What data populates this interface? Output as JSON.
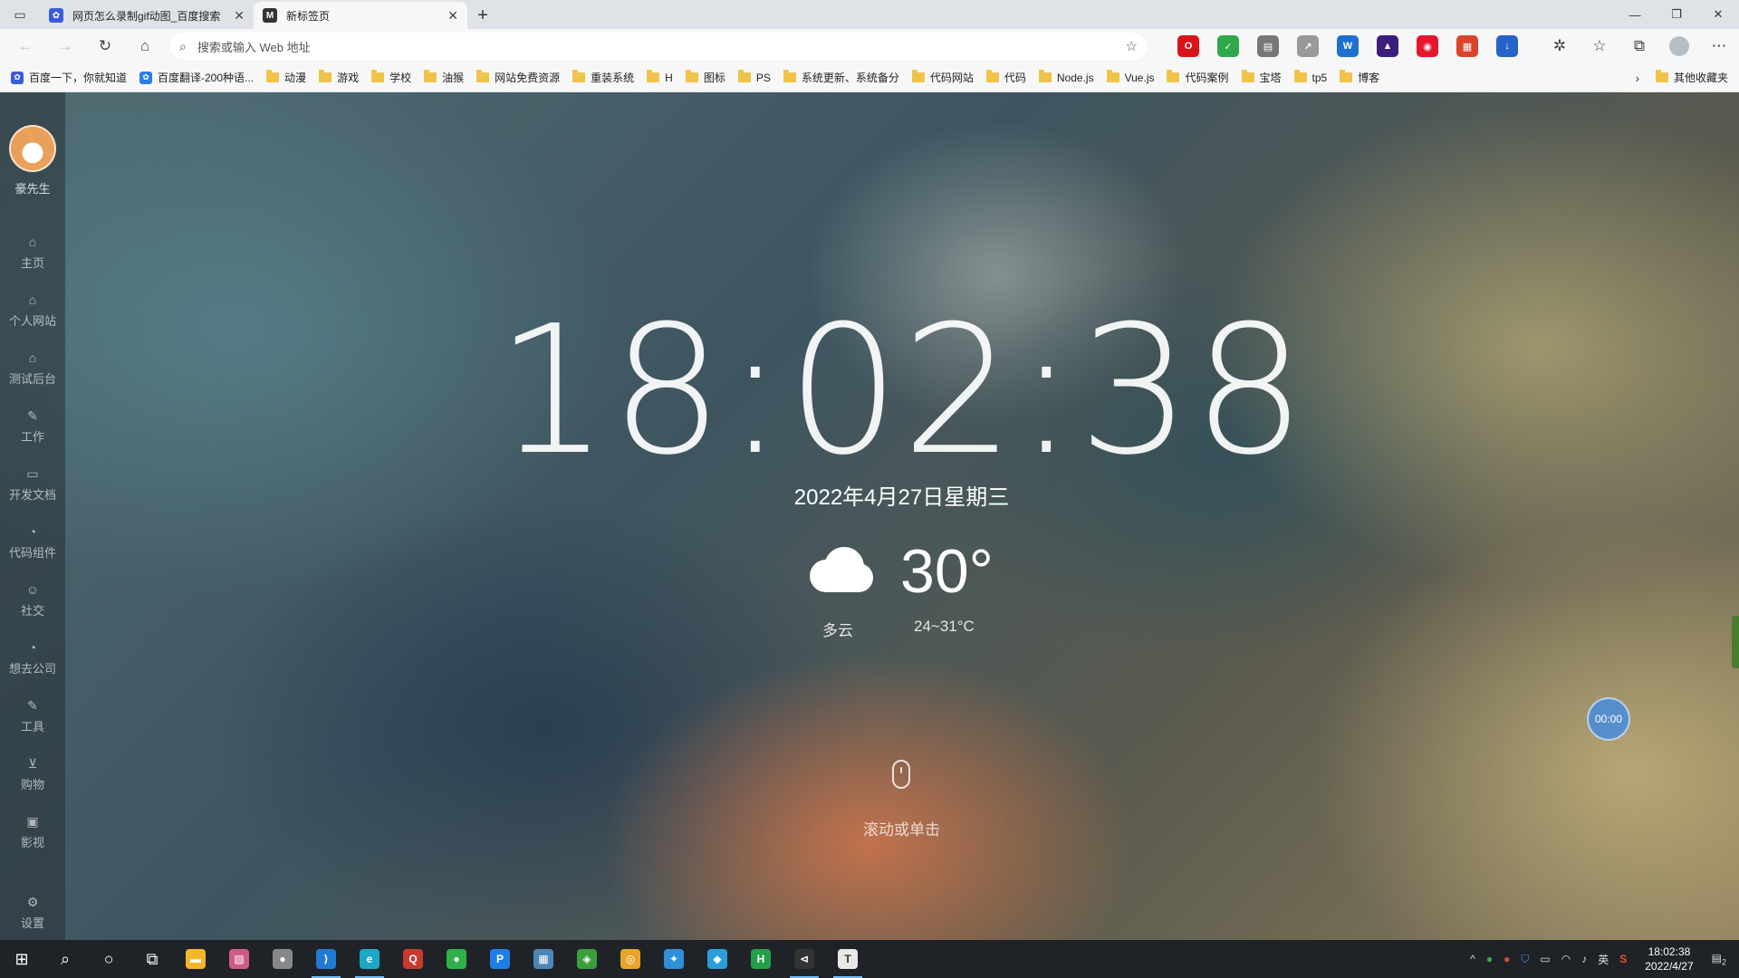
{
  "browser": {
    "tabs": [
      {
        "title": "网页怎么录制gif动图_百度搜索",
        "active": false,
        "fav_color": "#3a5bd9",
        "fav_icon": "baidu-paw-icon"
      },
      {
        "title": "新标签页",
        "active": true,
        "fav_color": "#333333",
        "fav_icon": "newtab-icon"
      }
    ],
    "address_placeholder": "搜索或输入 Web 地址",
    "bookmarks": [
      {
        "label": "百度一下，你就知道",
        "type": "site",
        "color": "#3a5bd9"
      },
      {
        "label": "百度翻译-200种语...",
        "type": "site",
        "color": "#2b7de9"
      },
      {
        "label": "动漫",
        "type": "folder"
      },
      {
        "label": "游戏",
        "type": "folder"
      },
      {
        "label": "学校",
        "type": "folder"
      },
      {
        "label": "油猴",
        "type": "folder"
      },
      {
        "label": "网站免费资源",
        "type": "folder"
      },
      {
        "label": "重装系统",
        "type": "folder"
      },
      {
        "label": "H",
        "type": "folder"
      },
      {
        "label": "图标",
        "type": "folder"
      },
      {
        "label": "PS",
        "type": "folder"
      },
      {
        "label": "系统更新、系统备分",
        "type": "folder"
      },
      {
        "label": "代码网站",
        "type": "folder"
      },
      {
        "label": "代码",
        "type": "folder"
      },
      {
        "label": "Node.js",
        "type": "folder"
      },
      {
        "label": "Vue.js",
        "type": "folder"
      },
      {
        "label": "代码案例",
        "type": "folder"
      },
      {
        "label": "宝塔",
        "type": "folder"
      },
      {
        "label": "tp5",
        "type": "folder"
      },
      {
        "label": "博客",
        "type": "folder"
      }
    ],
    "other_bookmarks": "其他收藏夹",
    "extensions": [
      {
        "name": "opera-icon",
        "color": "#d8131a",
        "glyph": "O"
      },
      {
        "name": "shield-ext-icon",
        "color": "#2ea84a",
        "glyph": "✓"
      },
      {
        "name": "reader-ext-icon",
        "color": "#777777",
        "glyph": "▤"
      },
      {
        "name": "chart-ext-icon",
        "color": "#999999",
        "glyph": "↗"
      },
      {
        "name": "word-ext-icon",
        "color": "#1f6fd1",
        "glyph": "W"
      },
      {
        "name": "purple-ext-icon",
        "color": "#3b1f7a",
        "glyph": "▲"
      },
      {
        "name": "weibo-ext-icon",
        "color": "#e6162d",
        "glyph": "◉"
      },
      {
        "name": "apps-ext-icon",
        "color": "#d9452b",
        "glyph": "▦"
      },
      {
        "name": "download-ext-icon",
        "color": "#2563c9",
        "glyph": "↓"
      }
    ]
  },
  "sidebar": {
    "username": "豪先生",
    "items": [
      {
        "label": "主页",
        "icon": "home-icon",
        "glyph": "⌂"
      },
      {
        "label": "个人网站",
        "icon": "home-icon",
        "glyph": "⌂"
      },
      {
        "label": "测试后台",
        "icon": "home-icon",
        "glyph": "⌂"
      },
      {
        "label": "工作",
        "icon": "wrench-icon",
        "glyph": "✎"
      },
      {
        "label": "开发文档",
        "icon": "calendar-icon",
        "glyph": "▭"
      },
      {
        "label": "代码组件",
        "icon": "pie-icon",
        "glyph": "◔"
      },
      {
        "label": "社交",
        "icon": "smile-icon",
        "glyph": "☺"
      },
      {
        "label": "想去公司",
        "icon": "pie-icon",
        "glyph": "◔"
      },
      {
        "label": "工具",
        "icon": "wrench-icon",
        "glyph": "✎"
      },
      {
        "label": "购物",
        "icon": "cart-icon",
        "glyph": "⊻"
      },
      {
        "label": "影视",
        "icon": "video-icon",
        "glyph": "▣"
      }
    ],
    "settings_label": "设置"
  },
  "main": {
    "time": "18:02:38",
    "date": "2022年4月27日星期三",
    "weather": {
      "temperature": "30°",
      "condition": "多云",
      "range": "24~31°C"
    },
    "hint": "滚动或单击",
    "timer": "00:00"
  },
  "taskbar": {
    "apps": [
      {
        "name": "start-icon",
        "glyph": "⊞",
        "color": "transparent"
      },
      {
        "name": "search-icon",
        "glyph": "⌕",
        "color": "transparent"
      },
      {
        "name": "cortana-icon",
        "glyph": "○",
        "color": "transparent"
      },
      {
        "name": "taskview-icon",
        "glyph": "⧉",
        "color": "transparent"
      },
      {
        "name": "file-explorer-icon",
        "glyph": "▬",
        "color": "#f3b62b"
      },
      {
        "name": "photo-app-icon",
        "glyph": "▧",
        "color": "#d05a8a"
      },
      {
        "name": "chat-app-icon",
        "glyph": "●",
        "color": "#888888"
      },
      {
        "name": "vscode-icon",
        "glyph": "⟩",
        "color": "#1f7bd6"
      },
      {
        "name": "edge-icon",
        "glyph": "e",
        "color": "#1ca7c6"
      },
      {
        "name": "qq-icon",
        "glyph": "Q",
        "color": "#c83a2e"
      },
      {
        "name": "wechat-icon",
        "glyph": "●",
        "color": "#2db24a"
      },
      {
        "name": "p-app-icon",
        "glyph": "P",
        "color": "#1e7ee6"
      },
      {
        "name": "network-app-icon",
        "glyph": "▦",
        "color": "#4b86b4"
      },
      {
        "name": "game-app-icon",
        "glyph": "◈",
        "color": "#3a9e3a"
      },
      {
        "name": "chrome-like-icon",
        "glyph": "◎",
        "color": "#e8a42b"
      },
      {
        "name": "share-app-icon",
        "glyph": "✦",
        "color": "#2f8fd8"
      },
      {
        "name": "cube-app-icon",
        "glyph": "◆",
        "color": "#2a9ed8"
      },
      {
        "name": "hbuilder-icon",
        "glyph": "H",
        "color": "#22a04a"
      },
      {
        "name": "terminal-app-icon",
        "glyph": "⊲",
        "color": "#333333"
      },
      {
        "name": "typora-icon",
        "glyph": "T",
        "color": "#e8e8e8"
      }
    ],
    "ime": "英",
    "time": "18:02:38",
    "date": "2022/4/27",
    "notifications": "2"
  }
}
